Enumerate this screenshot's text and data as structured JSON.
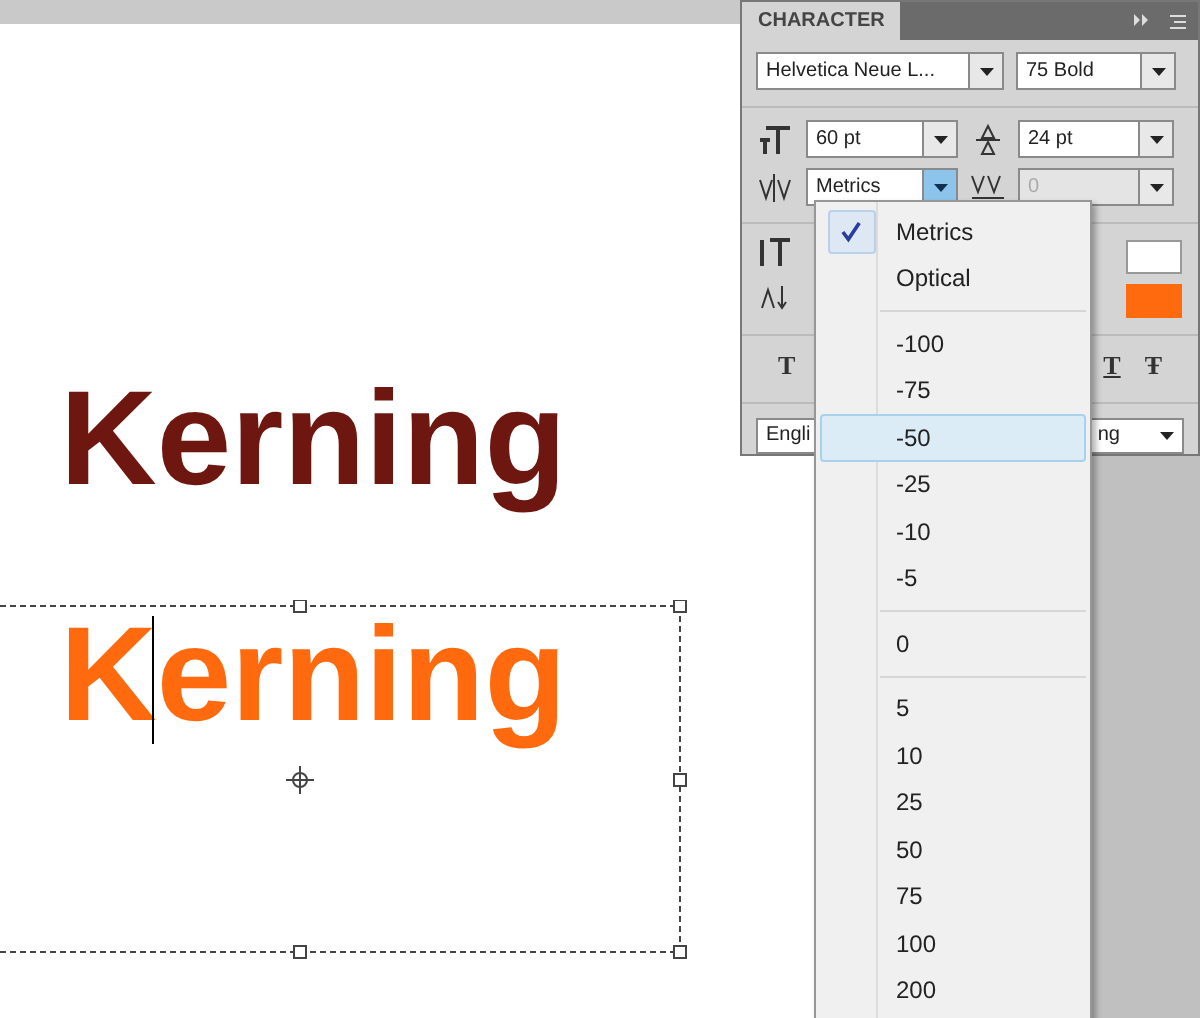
{
  "canvas": {
    "samples": [
      {
        "text": "Kerning",
        "color": "#6e1610",
        "cursor": false
      },
      {
        "text": "Kerning",
        "color": "#ff6a0e",
        "cursor": true
      }
    ]
  },
  "panel": {
    "title": "CHARACTER",
    "font_family": "Helvetica Neue L...",
    "font_style": "75 Bold",
    "font_size": "60 pt",
    "leading": "24 pt",
    "kerning": "Metrics",
    "tracking": {
      "value": "0",
      "disabled": true
    },
    "color": "#ff6a0e",
    "style_buttons": [
      "T",
      "T",
      "Ŧ"
    ],
    "language_start": "Engli",
    "language_end": "ng"
  },
  "menu": {
    "items": [
      {
        "kind": "item",
        "label": "Metrics",
        "checked": true,
        "selected": false
      },
      {
        "kind": "item",
        "label": "Optical",
        "checked": false,
        "selected": false
      },
      {
        "kind": "separator"
      },
      {
        "kind": "item",
        "label": "-100",
        "checked": false,
        "selected": false
      },
      {
        "kind": "item",
        "label": "-75",
        "checked": false,
        "selected": false
      },
      {
        "kind": "item",
        "label": "-50",
        "checked": false,
        "selected": true
      },
      {
        "kind": "item",
        "label": "-25",
        "checked": false,
        "selected": false
      },
      {
        "kind": "item",
        "label": "-10",
        "checked": false,
        "selected": false
      },
      {
        "kind": "item",
        "label": "-5",
        "checked": false,
        "selected": false
      },
      {
        "kind": "separator"
      },
      {
        "kind": "item",
        "label": "0",
        "checked": false,
        "selected": false
      },
      {
        "kind": "separator"
      },
      {
        "kind": "item",
        "label": "5",
        "checked": false,
        "selected": false
      },
      {
        "kind": "item",
        "label": "10",
        "checked": false,
        "selected": false
      },
      {
        "kind": "item",
        "label": "25",
        "checked": false,
        "selected": false
      },
      {
        "kind": "item",
        "label": "50",
        "checked": false,
        "selected": false
      },
      {
        "kind": "item",
        "label": "75",
        "checked": false,
        "selected": false
      },
      {
        "kind": "item",
        "label": "100",
        "checked": false,
        "selected": false
      },
      {
        "kind": "item",
        "label": "200",
        "checked": false,
        "selected": false
      }
    ]
  }
}
